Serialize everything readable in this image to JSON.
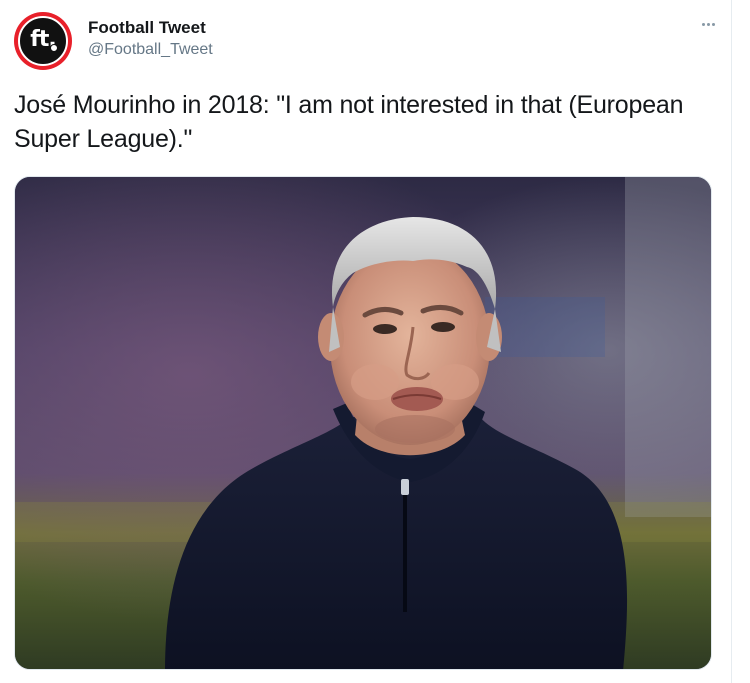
{
  "account": {
    "display_name": "Football Tweet",
    "handle": "@Football_Tweet",
    "avatar_text": "ft."
  },
  "tweet": {
    "text": "José Mourinho in 2018: \"I am not interested in that (European Super League).\""
  },
  "icons": {
    "more": "more-horizontal-icon"
  },
  "colors": {
    "avatar_ring": "#e8202a",
    "avatar_fill": "#111111",
    "name": "#14171a",
    "handle": "#657786"
  }
}
